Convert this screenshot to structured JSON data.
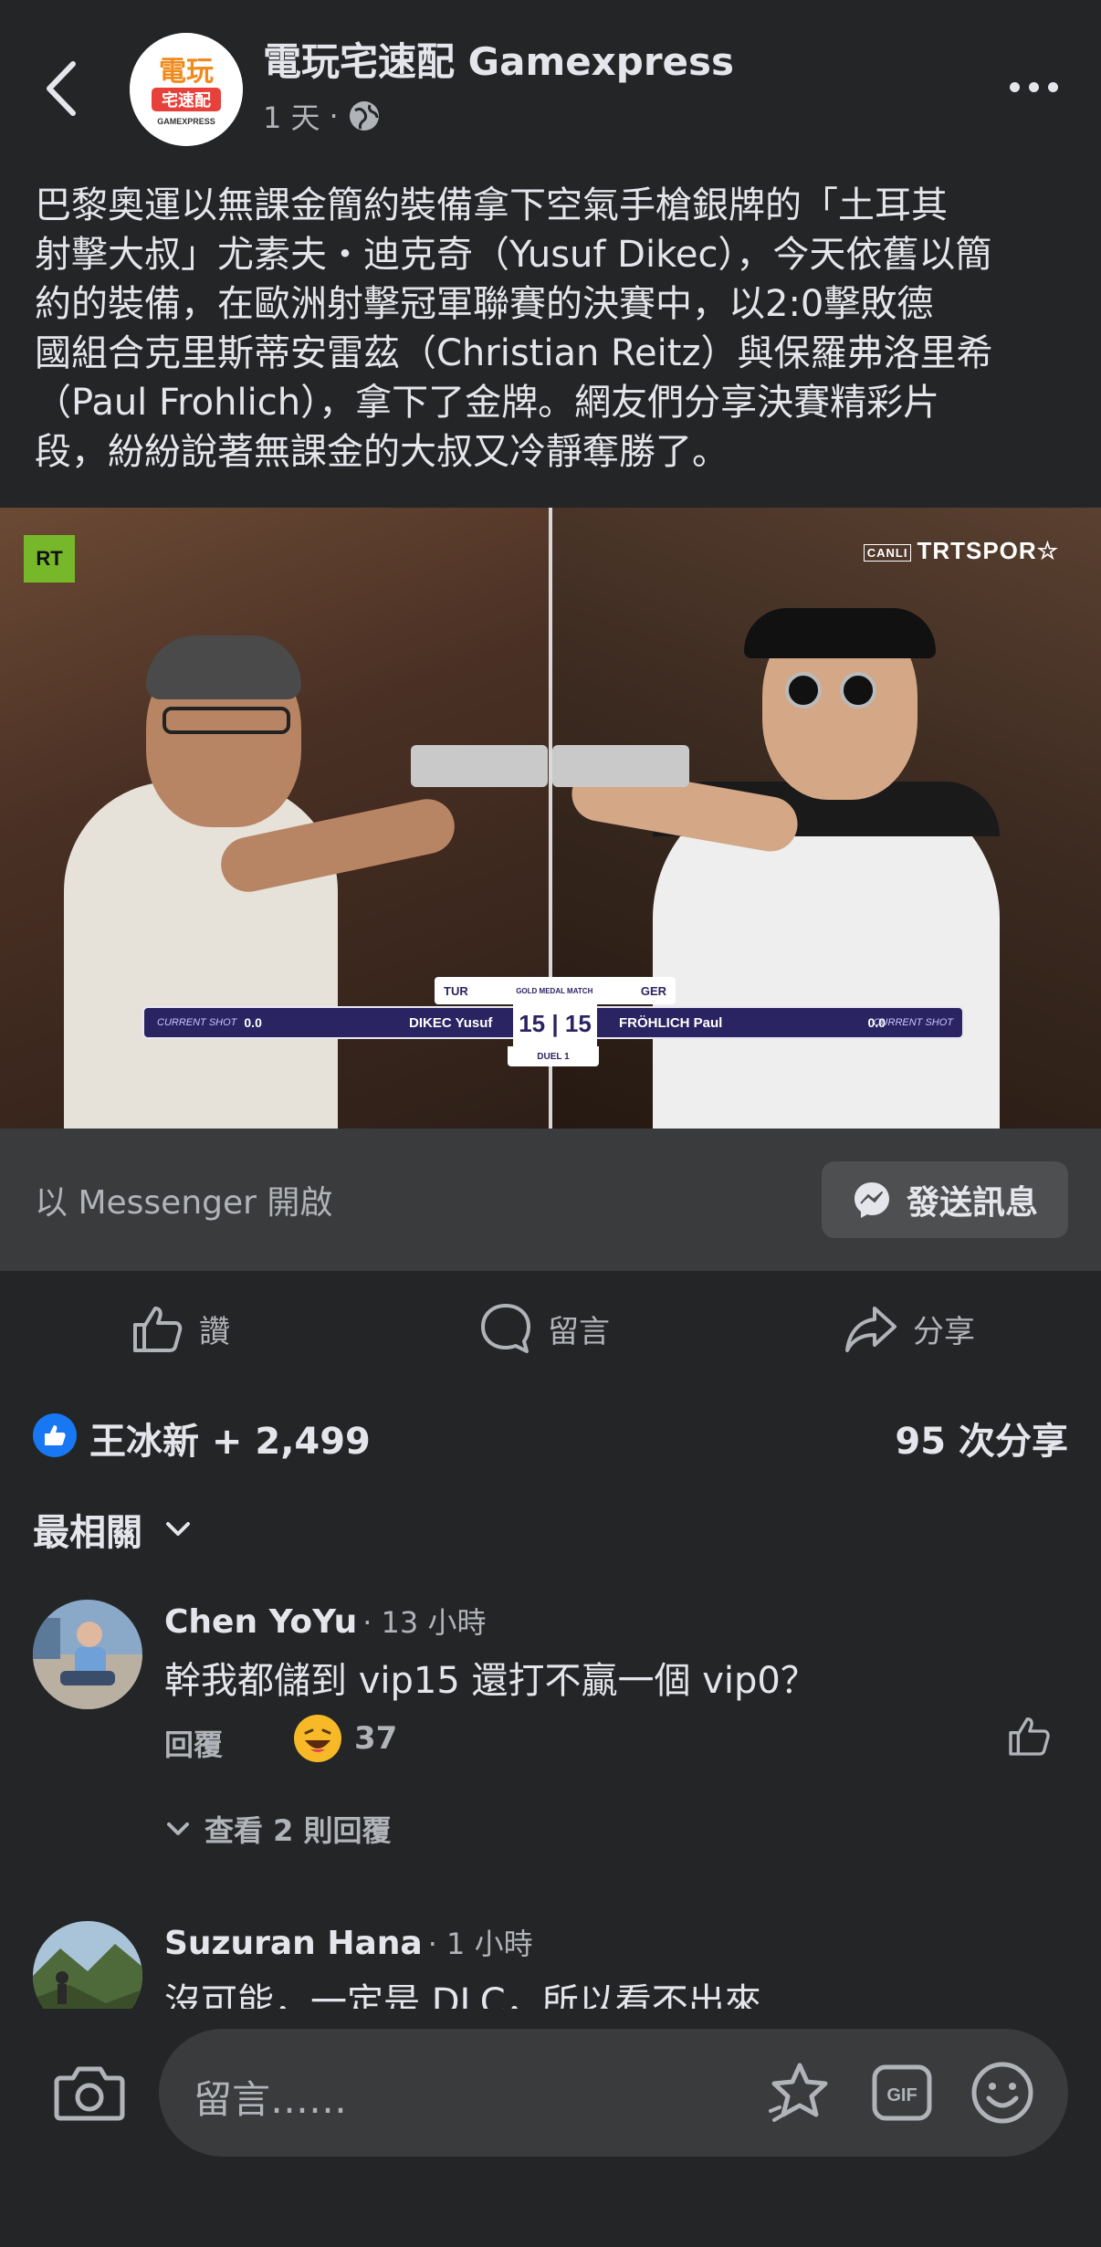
{
  "header": {
    "page_name": "電玩宅速配 Gamexpress",
    "time": "1 天",
    "separator": "·",
    "logo_text_top": "電玩",
    "logo_text_mid": "宅速配",
    "logo_text_bottom": "GAMEXPRESS"
  },
  "post": {
    "text": "巴黎奧運以無課金簡約裝備拿下空氣手槍銀牌的「土耳其\n射擊大叔」尤素夫・迪克奇（Yusuf Dikec），今天依舊以簡\n約的裝備，在歐洲射擊冠軍聯賽的決賽中，以2:0擊敗德\n國組合克里斯蒂安雷茲（Christian Reitz）與保羅弗洛里希\n（Paul Frohlich），拿下了金牌。網友們分享決賽精彩片\n段，紛紛說著無課金的大叔又冷靜奪勝了。"
  },
  "video": {
    "rt_logo": "RT",
    "trt_canli": "CANLI",
    "trt_logo": "TRTSPOR",
    "score_left_country": "TUR",
    "score_match": "GOLD MEDAL MATCH",
    "score_right_country": "GER",
    "current_shot_label": "CURRENT SHOT",
    "left_shot": "0.0",
    "left_name": "DIKEC Yusuf",
    "score": "15 | 15",
    "right_name": "FRÖHLICH Paul",
    "right_shot": "0.0",
    "duel": "DUEL 1"
  },
  "messenger": {
    "label": "以 Messenger 開啟",
    "button": "發送訊息"
  },
  "actions": {
    "like": "讚",
    "comment": "留言",
    "share": "分享"
  },
  "reactions": {
    "summary": "王冰新 + 2,499",
    "shares": "95 次分享"
  },
  "sort": {
    "label": "最相關"
  },
  "comments": [
    {
      "name": "Chen YoYu",
      "time": "· 13 小時",
      "text": "幹我都儲到 vip15 還打不贏一個 vip0？",
      "reply": "回覆",
      "reaction_count": "37",
      "view_replies": "查看 2 則回覆"
    },
    {
      "name": "Suzuran Hana",
      "time": "· 1 小時",
      "text": "沒可能，一定是 DLC，所以看不出來"
    }
  ],
  "composer": {
    "placeholder": "留言……",
    "gif": "GIF"
  },
  "colors": {
    "background": "#242526",
    "surface": "#3a3b3c",
    "text_primary": "#e4e6eb",
    "text_secondary": "#b0b3b8",
    "like_blue": "#1877f2"
  }
}
